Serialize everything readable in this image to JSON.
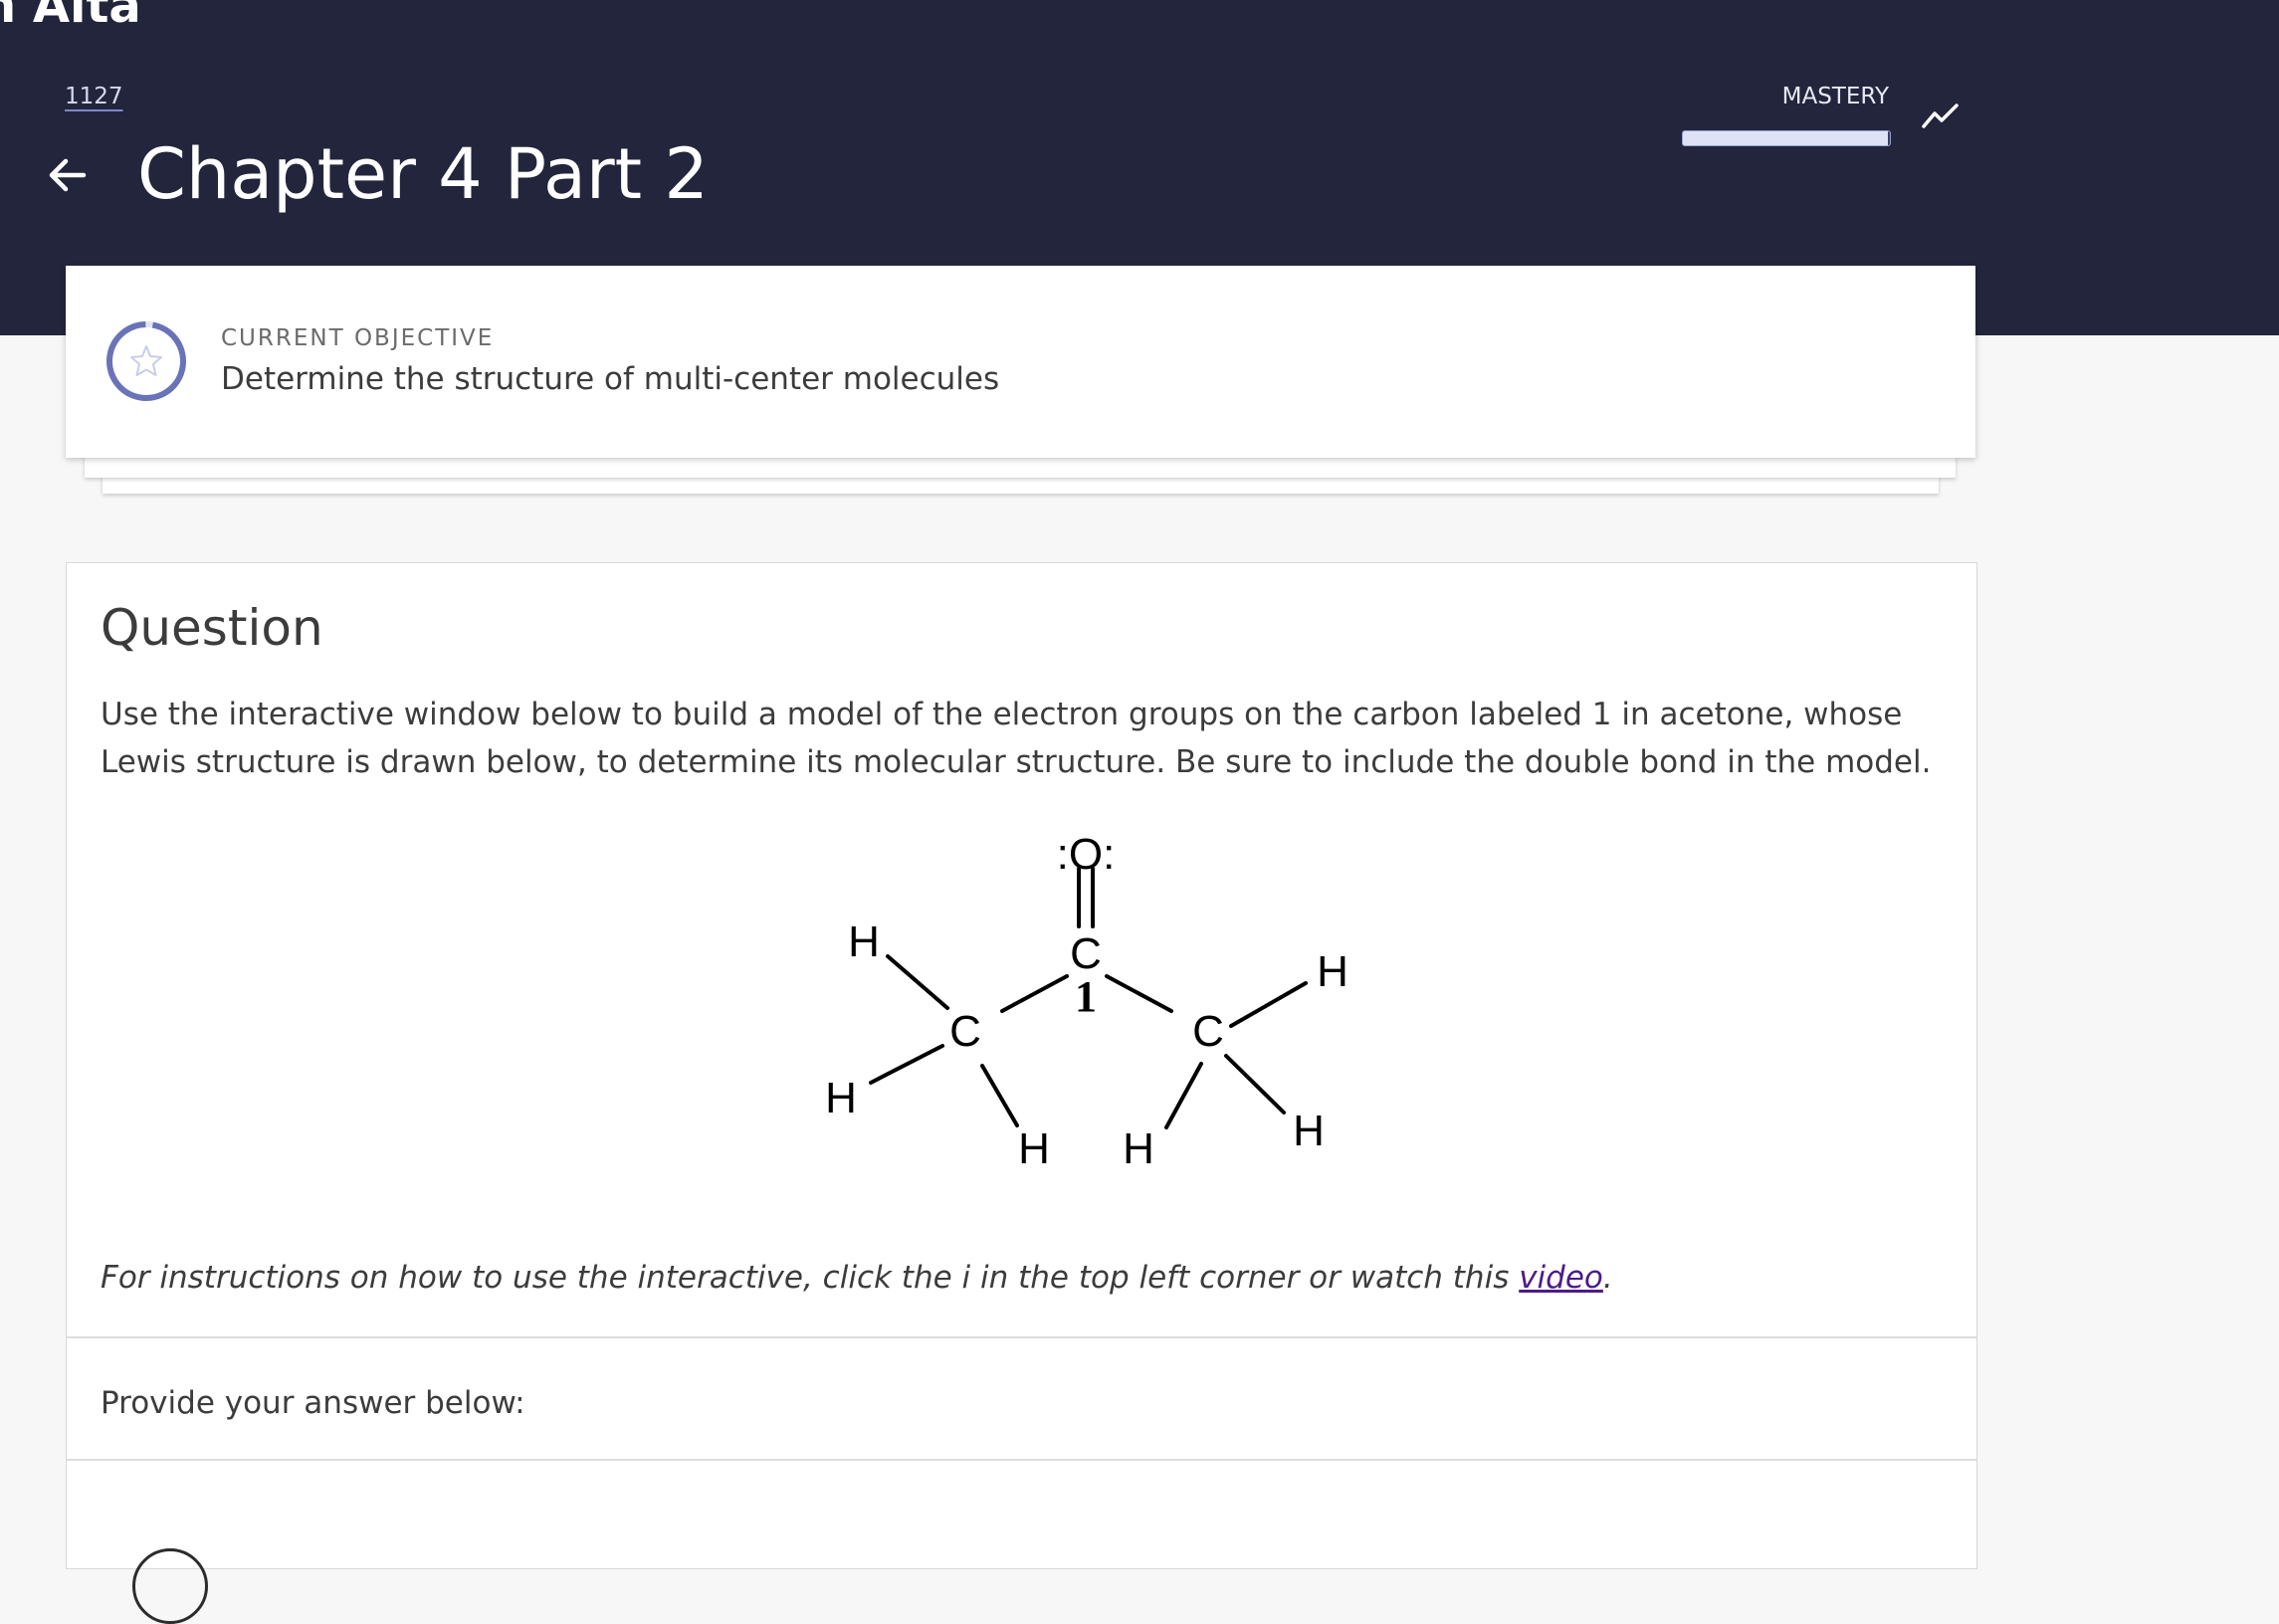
{
  "app": {
    "title": "n Alta"
  },
  "header": {
    "course_id": "1127",
    "title": "Chapter 4 Part 2",
    "mastery_label": "MASTERY",
    "mastery_progress": 0.99
  },
  "objective": {
    "kicker": "CURRENT OBJECTIVE",
    "text": "Determine the structure of multi-center molecules"
  },
  "question": {
    "heading": "Question",
    "prompt": "Use the interactive window below to build a model of the electron groups on the carbon labeled 1 in acetone, whose Lewis structure is drawn below, to determine its molecular structure. Be sure to include the double bond in the model.",
    "instructions_prefix": "For instructions on how to use the interactive, click the i in the top left corner or watch this ",
    "instructions_link": "video",
    "instructions_suffix": ".",
    "molecule_labels": {
      "oxygen": ":O:",
      "carbon": "C",
      "carbon_number": "1",
      "hydrogen": "H"
    }
  },
  "answer": {
    "label": "Provide your answer below:"
  },
  "colors": {
    "header_bg": "#22253b",
    "accent": "#6a72b8",
    "link": "#4b1c8a"
  },
  "icons": [
    "back-arrow-icon",
    "trend-chart-icon",
    "star-icon"
  ]
}
